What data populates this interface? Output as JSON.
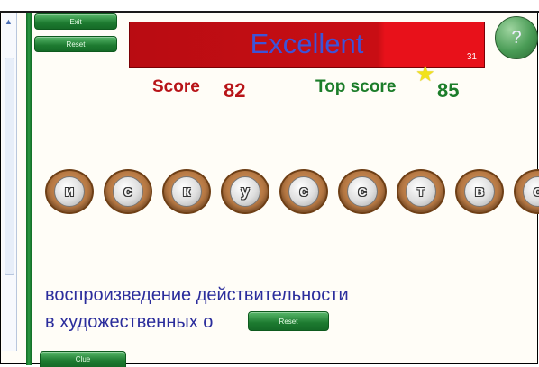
{
  "top_buttons": {
    "exit_label": "Exit",
    "reset_label": "Reset"
  },
  "banner": {
    "title": "Excellent",
    "count": "31"
  },
  "help": {
    "label": "?"
  },
  "scores": {
    "score_label": "Score",
    "score_value": "82",
    "top_label": "Top score",
    "top_value": "85"
  },
  "word": {
    "letters": [
      "и",
      "с",
      "к",
      "у",
      "с",
      "с",
      "т",
      "в",
      "о"
    ]
  },
  "definition": {
    "line1": "воспроизведение действительности",
    "line2": "в художественных о"
  },
  "bottom_buttons": {
    "reset_label": "Reset",
    "clue_label": "Clue"
  },
  "colors": {
    "banner_red": "#c80e14",
    "title_blue": "#3d53d8",
    "score_red": "#b81418",
    "top_green": "#1c7d2a",
    "ball_brown": "#b87a45",
    "text_blue": "#2b2d9c"
  }
}
